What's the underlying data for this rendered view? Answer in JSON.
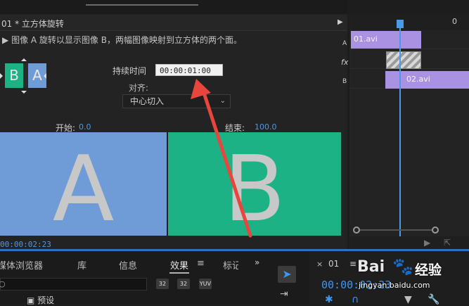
{
  "effect_controls": {
    "title": "01 * 立方体旋转",
    "description": "图像 A 旋转以显示图像 B，两幅图像映射到立方体的两个面。",
    "thumb_b": "B",
    "thumb_a": "A",
    "duration_label": "持续时间",
    "duration_value": "00:00:01:00",
    "align_label": "对齐:",
    "align_value": "中心切入",
    "start_label": "开始:",
    "start_value": "0.0",
    "end_label": "结束:",
    "end_value": "100.0",
    "preview_a_letter": "A",
    "preview_b_letter": "B",
    "timecode": "00:00:02:23"
  },
  "timeline": {
    "ruler_zero": "0",
    "clip1_name": "01.avi",
    "clip2_name": "02.avi",
    "track_a": "A",
    "track_fx": "fx",
    "track_b": "B"
  },
  "bottom_tabs": {
    "media_browser": "媒体浏览器",
    "library": "库",
    "info": "信息",
    "effects": "效果",
    "markers": "标记",
    "more": "»"
  },
  "effects_panel": {
    "buttons": [
      "32",
      "32",
      "YUV"
    ],
    "folder_label": "预设"
  },
  "sequence": {
    "close": "×",
    "name": "01",
    "menu": "≡",
    "time": "00:00:02:23"
  },
  "watermark": {
    "logo": "Bai",
    "brand": "经验",
    "url": "jingyan.baidu.com"
  },
  "colors": {
    "accent": "#4a9ae8",
    "clip": "#a992e1",
    "preview_a": "#6f9bd6",
    "preview_b": "#1db286",
    "arrow": "#e8453c"
  }
}
